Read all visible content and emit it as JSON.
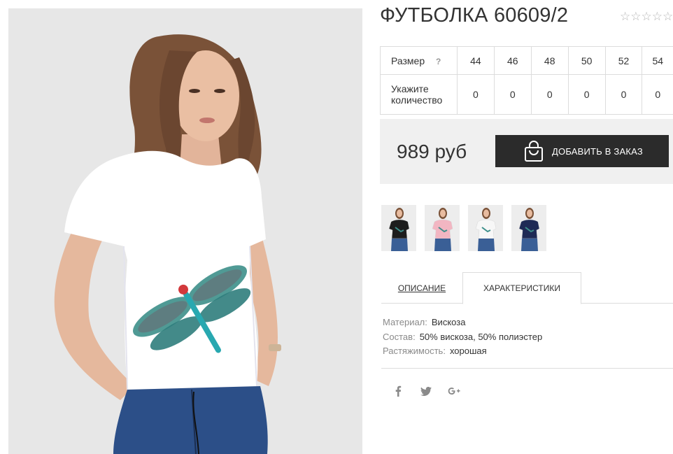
{
  "product": {
    "title": "ФУТБОЛКА 60609/2",
    "rating_stars": "☆☆☆☆☆",
    "rating_value": 0
  },
  "size_table": {
    "size_label": "Размер",
    "help_label": "?",
    "qty_label_line1": "Укажите",
    "qty_label_line2": "количество",
    "sizes": [
      "44",
      "46",
      "48",
      "50",
      "52",
      "54"
    ],
    "quantities": [
      "0",
      "0",
      "0",
      "0",
      "0",
      "0"
    ]
  },
  "buy": {
    "price": "989 руб",
    "button_label": "ДОБАВИТЬ В ЗАКАЗ",
    "button_icon": "shopping-bag-icon"
  },
  "thumbnails": [
    {
      "color_name": "black",
      "shirt_color": "#1d1d1d"
    },
    {
      "color_name": "pink",
      "shirt_color": "#f2b6c2"
    },
    {
      "color_name": "white",
      "shirt_color": "#f7f7f7"
    },
    {
      "color_name": "navy",
      "shirt_color": "#1f2a55"
    }
  ],
  "tabs": {
    "description": "ОПИСАНИЕ",
    "specs": "ХАРАКТЕРИСТИКИ",
    "active": "specs"
  },
  "specs": [
    {
      "key": "Материал:",
      "value": "Вискоза"
    },
    {
      "key": "Состав:",
      "value": "50% вискоза, 50% полиэстер"
    },
    {
      "key": "Растяжимость:",
      "value": "хорошая"
    }
  ],
  "social": [
    {
      "name": "facebook-icon",
      "glyph": "f"
    },
    {
      "name": "twitter-icon",
      "glyph": "t"
    },
    {
      "name": "google-plus-icon",
      "glyph": "g+"
    }
  ],
  "colors": {
    "text": "#333333",
    "muted": "#8a8a8a",
    "button_bg": "#2b2b2b",
    "buy_panel_bg": "#f0f0f0",
    "border": "#dcdcdc"
  }
}
